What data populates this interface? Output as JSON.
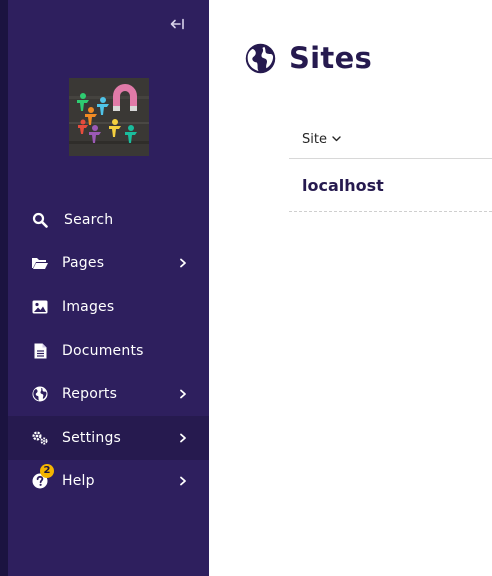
{
  "sidebar": {
    "collapse_glyph": "⇤",
    "menu": [
      {
        "label": "Search",
        "icon": "search-icon",
        "has_submenu": false
      },
      {
        "label": "Pages",
        "icon": "folder-open-icon",
        "has_submenu": true
      },
      {
        "label": "Images",
        "icon": "image-icon",
        "has_submenu": false
      },
      {
        "label": "Documents",
        "icon": "document-icon",
        "has_submenu": false
      },
      {
        "label": "Reports",
        "icon": "globe-icon",
        "has_submenu": true
      },
      {
        "label": "Settings",
        "icon": "cogs-icon",
        "has_submenu": true,
        "active": true
      },
      {
        "label": "Help",
        "icon": "help-icon",
        "has_submenu": true,
        "badge": "2"
      }
    ]
  },
  "main": {
    "title": "Sites",
    "title_icon": "globe-icon",
    "table": {
      "column_header": "Site",
      "rows": [
        "localhost"
      ]
    }
  },
  "colors": {
    "sidebar_bg": "#2e1f5e",
    "sidebar_active_bg": "#261a4f",
    "accent_text": "#261a4f",
    "badge": "#f4b400"
  }
}
